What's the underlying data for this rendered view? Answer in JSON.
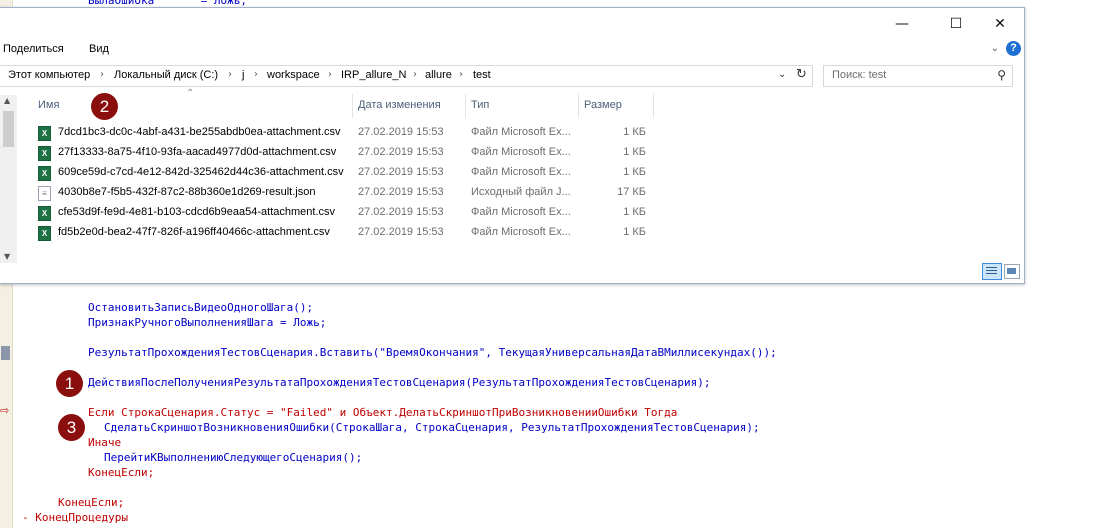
{
  "editor": {
    "line_top": "БылаОшибка       = Ложь;",
    "line_partial": "[...]",
    "lines": [
      "ОстановитьЗаписьВидеоОдногоШага();",
      "ПризнакРучногоВыполненияШага = Ложь;",
      "РезультатПрохожденияТестовСценария.Вставить(\"ВремяОкончания\", ТекущаяУниверсальнаяДатаВМиллисекундах());",
      "ДействияПослеПолученияРезультатаПрохожденияТестовСценария(РезультатПрохожденияТестовСценария);",
      "Если СтрокаСценария.Статус = \"Failed\" и Объект.ДелатьСкриншотПриВозникновенииОшибки Тогда",
      "СделатьСкриншотВозникновенияОшибки(СтрокаШага, СтрокаСценария, РезультатПрохожденияТестовСценария);",
      "Иначе",
      "ПерейтиКВыполнениюСледующегоСценария();",
      "КонецЕсли;",
      "КонецЕсли;",
      "КонецПроцедуры"
    ],
    "markers": [
      "1",
      "2",
      "3"
    ]
  },
  "explorer": {
    "ribbon_tabs": [
      "Поделиться",
      "Вид"
    ],
    "window_controls": {
      "minimize": "—",
      "maximize": "☐",
      "close": "✕"
    },
    "help": "?",
    "breadcrumb": [
      "Этот компьютер",
      "Локальный диск (C:)",
      "j",
      "workspace",
      "IRP_allure_N",
      "allure",
      "test"
    ],
    "search_placeholder": "Поиск: test",
    "columns": {
      "name": "Имя",
      "date": "Дата изменения",
      "type": "Тип",
      "size": "Размер"
    },
    "files": [
      {
        "name": "7dcd1bc3-dc0c-4abf-a431-be255abdb0ea-attachment.csv",
        "date": "27.02.2019 15:53",
        "type": "Файл Microsoft Ex...",
        "size": "1 КБ",
        "icon": "excel-csv-icon"
      },
      {
        "name": "27f13333-8a75-4f10-93fa-aacad4977d0d-attachment.csv",
        "date": "27.02.2019 15:53",
        "type": "Файл Microsoft Ex...",
        "size": "1 КБ",
        "icon": "excel-csv-icon"
      },
      {
        "name": "609ce59d-c7cd-4e12-842d-325462d44c36-attachment.csv",
        "date": "27.02.2019 15:53",
        "type": "Файл Microsoft Ex...",
        "size": "1 КБ",
        "icon": "excel-csv-icon"
      },
      {
        "name": "4030b8e7-f5b5-432f-87c2-88b360e1d269-result.json",
        "date": "27.02.2019 15:53",
        "type": "Исходный файл J...",
        "size": "17 КБ",
        "icon": "json-file-icon"
      },
      {
        "name": "cfe53d9f-fe9d-4e81-b103-cdcd6b9eaa54-attachment.csv",
        "date": "27.02.2019 15:53",
        "type": "Файл Microsoft Ex...",
        "size": "1 КБ",
        "icon": "excel-csv-icon"
      },
      {
        "name": "fd5b2e0d-bea2-47f7-826f-a196ff40466c-attachment.csv",
        "date": "27.02.2019 15:53",
        "type": "Файл Microsoft Ex...",
        "size": "1 КБ",
        "icon": "excel-csv-icon"
      }
    ]
  },
  "colors": {
    "keyword": "#c00000",
    "identifier": "#0000c8",
    "marker": "#8b0e0e",
    "excel_icon": "#1e7145"
  }
}
